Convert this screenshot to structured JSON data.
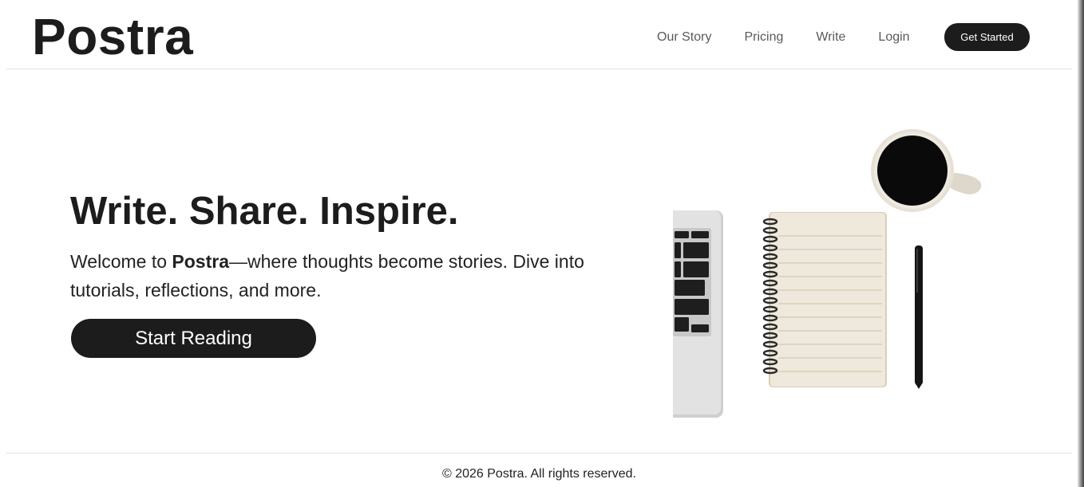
{
  "header": {
    "logo": "Postra",
    "nav": [
      "Our Story",
      "Pricing",
      "Write",
      "Login"
    ],
    "cta": "Get Started"
  },
  "hero": {
    "title": "Write. Share. Inspire.",
    "text_before": "Welcome to ",
    "text_brand": "Postra",
    "text_after": "—where thoughts become stories. Dive into tutorials, reflections, and more.",
    "button": "Start Reading"
  },
  "footer": {
    "copyright": "© 2026 Postra. All rights reserved."
  },
  "colors": {
    "primary": "#1c1c1c",
    "nav_text": "#5a5a5a",
    "background": "#ffffff",
    "divider": "#e2e2e2"
  },
  "icons": [
    "hero-desk-illustration"
  ]
}
